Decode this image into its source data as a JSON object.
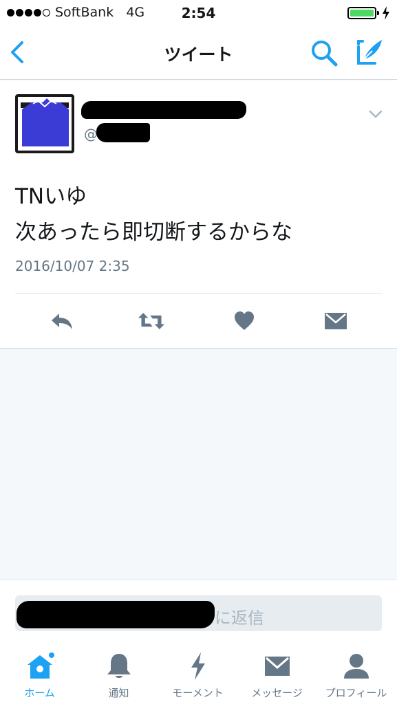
{
  "status_bar": {
    "carrier": "SoftBank",
    "network": "4G",
    "time": "2:54"
  },
  "nav": {
    "title": "ツイート"
  },
  "tweet": {
    "handle_prefix": "@",
    "text_lines": [
      "TNいゆ",
      "次あったら即切断するからな"
    ],
    "timestamp": "2016/10/07 2:35"
  },
  "reply": {
    "placeholder_suffix": "に返信"
  },
  "tabs": [
    {
      "label": "ホーム",
      "active": true
    },
    {
      "label": "通知",
      "active": false
    },
    {
      "label": "モーメント",
      "active": false
    },
    {
      "label": "メッセージ",
      "active": false
    },
    {
      "label": "プロフィール",
      "active": false
    }
  ],
  "colors": {
    "accent": "#1da1f2",
    "icon_gray": "#657786",
    "battery": "#4cd964"
  }
}
